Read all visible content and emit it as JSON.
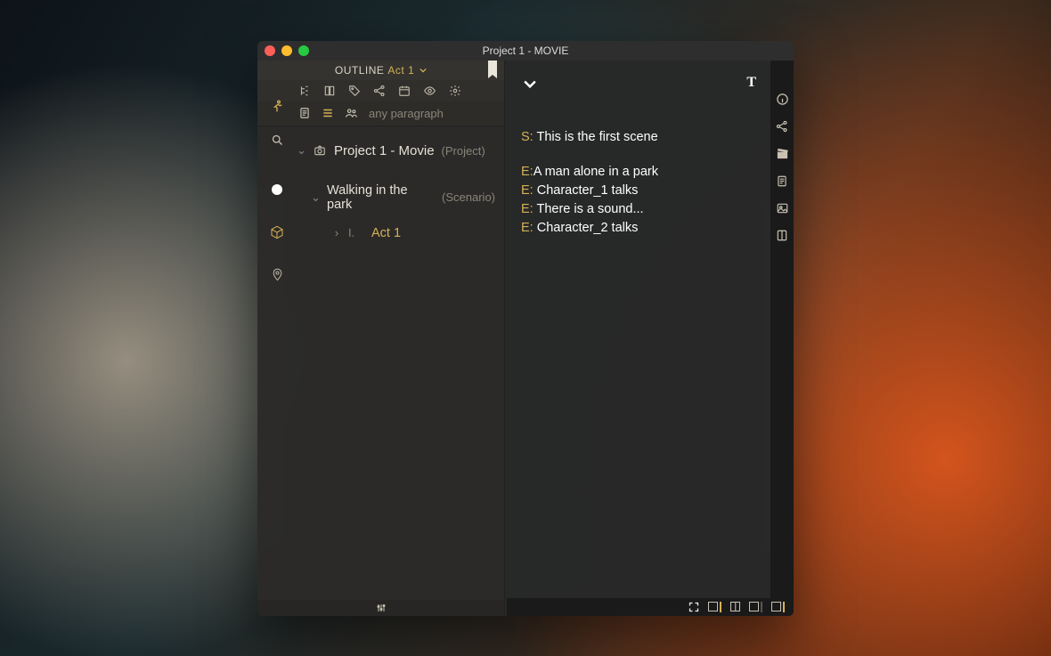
{
  "window": {
    "title": "Project 1 - MOVIE"
  },
  "left": {
    "header": {
      "label": "OUTLINE",
      "selection": "Act 1"
    },
    "filter": {
      "placeholder": "any paragraph"
    },
    "tree": {
      "project": {
        "name": "Project 1 - Movie",
        "kind": "(Project)"
      },
      "scenario": {
        "name": "Walking in the park",
        "kind": "(Scenario)"
      },
      "act": {
        "numeral": "I.",
        "name": "Act 1"
      }
    }
  },
  "editor": {
    "lines": [
      {
        "prefix": "S: ",
        "text": "This is the first scene"
      },
      {
        "prefix": "E:",
        "text": "A man alone in a park"
      },
      {
        "prefix": "E: ",
        "text": "Character_1 talks"
      },
      {
        "prefix": "E: ",
        "text": "There is a sound..."
      },
      {
        "prefix": "E: ",
        "text": "Character_2 talks"
      }
    ]
  }
}
